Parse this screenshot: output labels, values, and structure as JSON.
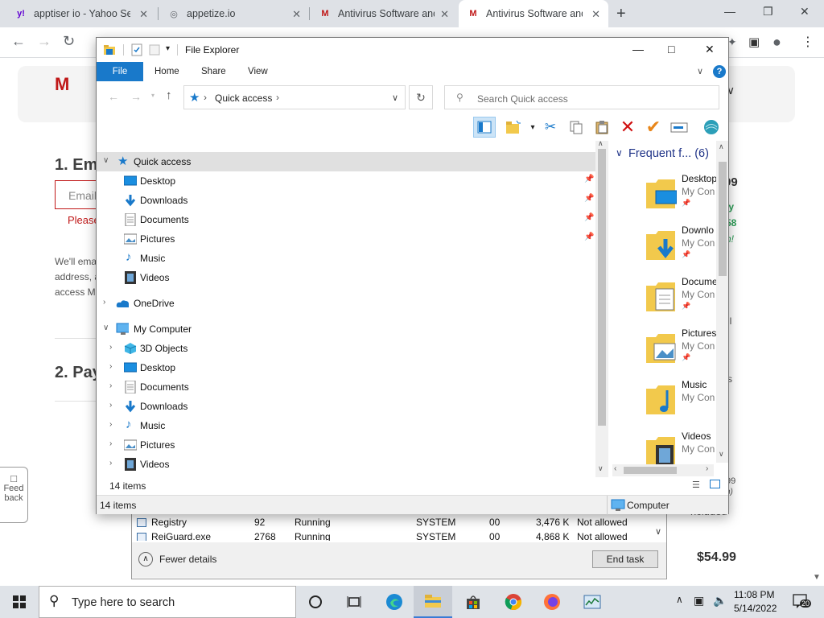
{
  "browser": {
    "tabs": [
      {
        "title": "apptiser io - Yahoo Sea",
        "favicon": "yahoo-icon",
        "favicon_char": "y!",
        "favicon_color": "#6001d2"
      },
      {
        "title": "appetize.io",
        "favicon": "globe-icon",
        "favicon_char": "◎",
        "favicon_color": "#5f6368"
      },
      {
        "title": "Antivirus Software and",
        "favicon": "mcafee-icon",
        "favicon_char": "M",
        "favicon_color": "#c01818"
      },
      {
        "title": "Antivirus Software and",
        "favicon": "mcafee-icon",
        "favicon_char": "M",
        "favicon_color": "#c01818"
      }
    ],
    "close_char": "✕",
    "new_tab": "+",
    "window_controls": {
      "minimize": "—",
      "restore": "❐",
      "close": "✕"
    },
    "nav": {
      "back": "←",
      "forward": "→",
      "reload": "↻"
    },
    "toolbar_icons": {
      "extensions": "✦",
      "sidebar": "▣",
      "profile": "●",
      "menu": "⋮"
    }
  },
  "page": {
    "logo": "M",
    "heading_1": "1. Em",
    "email_placeholder": "Email",
    "please_text": "Please",
    "info_line1": "We'll ema",
    "info_line2": "address, a",
    "info_line3": "access M",
    "heading_2": "2. Pay",
    "feedback_line1": "Feed",
    "feedback_line2": "back",
    "right_fragments": {
      "a": "99",
      "b": "ly",
      "c": "58",
      "d": "h!",
      "e": "ll",
      "f": "s",
      "g": "99",
      "h": "h)",
      "i": "ncluded"
    },
    "price": "$54.99",
    "header_chevron": "s ∨"
  },
  "task_manager": {
    "rows": [
      {
        "name": "Registry",
        "pid": "92",
        "status": "Running",
        "user": "SYSTEM",
        "cpu": "00",
        "mem": "3,476 K",
        "uac": "Not allowed"
      },
      {
        "name": "ReiGuard.exe",
        "pid": "2768",
        "status": "Running",
        "user": "SYSTEM",
        "cpu": "00",
        "mem": "4,868 K",
        "uac": "Not allowed"
      }
    ],
    "fewer_details": "Fewer details",
    "end_task": "End task"
  },
  "explorer": {
    "title": "File Explorer",
    "ribbon_tabs": {
      "file": "File",
      "home": "Home",
      "share": "Share",
      "view": "View"
    },
    "help": "?",
    "address": "Quick access",
    "search_placeholder": "Search Quick access",
    "nav": {
      "quick_access": "Quick access",
      "qa_items": [
        "Desktop",
        "Downloads",
        "Documents",
        "Pictures",
        "Music",
        "Videos"
      ],
      "onedrive": "OneDrive",
      "my_computer": "My Computer",
      "pc_items": [
        "3D Objects",
        "Desktop",
        "Documents",
        "Downloads",
        "Music",
        "Pictures",
        "Videos"
      ]
    },
    "frequent_header": "Frequent f... (6)",
    "tiles": [
      {
        "name": "Desktop",
        "sub": "My Con",
        "icon": "desktop-icon"
      },
      {
        "name": "Downlo",
        "sub": "My Con",
        "icon": "downloads-icon"
      },
      {
        "name": "Docume",
        "sub": "My Con",
        "icon": "documents-icon"
      },
      {
        "name": "Pictures",
        "sub": "My Con",
        "icon": "pictures-icon"
      },
      {
        "name": "Music",
        "sub": "My Con",
        "icon": "music-icon"
      },
      {
        "name": "Videos",
        "sub": "My Con",
        "icon": "videos-icon"
      }
    ],
    "item_count_mid": "14 items",
    "status_items": "14 items",
    "status_location": "Computer"
  },
  "taskbar": {
    "search_placeholder": "Type here to search",
    "time": "11:08 PM",
    "date": "5/14/2022",
    "notifications": "20"
  },
  "colors": {
    "accent": "#1979ca",
    "mcafee_red": "#c01818",
    "folder_yellow": "#f2c94c"
  }
}
